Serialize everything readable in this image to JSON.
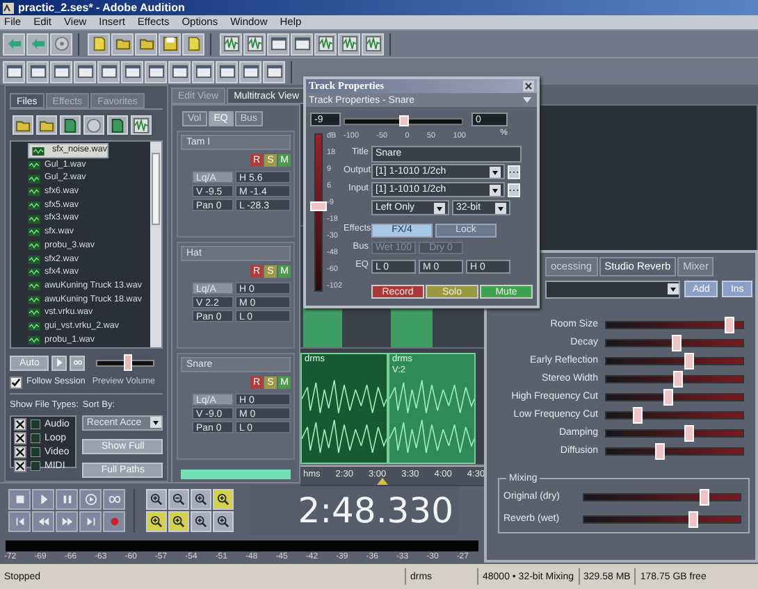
{
  "window": {
    "title": "practic_2.ses* - Adobe Audition"
  },
  "menu": [
    "File",
    "Edit",
    "View",
    "Insert",
    "Effects",
    "Options",
    "Window",
    "Help"
  ],
  "files_panel": {
    "tabs": [
      {
        "label": "Files",
        "selected": true
      },
      {
        "label": "Effects",
        "selected": false
      },
      {
        "label": "Favorites",
        "selected": false
      }
    ],
    "files": [
      {
        "name": "sfx_noise.wav",
        "selected": true
      },
      {
        "name": "Gul_1.wav",
        "selected": false
      },
      {
        "name": "Gul_2.wav",
        "selected": false
      },
      {
        "name": "sfx6.wav",
        "selected": false
      },
      {
        "name": "sfx5.wav",
        "selected": false
      },
      {
        "name": "sfx3.wav",
        "selected": false
      },
      {
        "name": "sfx.wav",
        "selected": false
      },
      {
        "name": "probu_3.wav",
        "selected": false
      },
      {
        "name": "sfx2.wav",
        "selected": false
      },
      {
        "name": "sfx4.wav",
        "selected": false
      },
      {
        "name": "awuKuning Truck 13.wav",
        "selected": false
      },
      {
        "name": "awuKuning Truck 18.wav",
        "selected": false
      },
      {
        "name": "vst.vrku.wav",
        "selected": false
      },
      {
        "name": "gui_vst.vrku_2.wav",
        "selected": false
      },
      {
        "name": "probu_1.wav",
        "selected": false
      }
    ],
    "autoplay": "Auto",
    "follow_session": {
      "label": "Follow Session",
      "checked": true
    },
    "preview_volume": {
      "label": "Preview Volume",
      "level": 0.55
    },
    "show_file_types": {
      "label": "Show File Types:",
      "types": [
        {
          "label": "Audio",
          "checked": true
        },
        {
          "label": "Loop",
          "checked": true
        },
        {
          "label": "Video",
          "checked": true
        },
        {
          "label": "MIDI",
          "checked": true
        }
      ]
    },
    "sort_by": {
      "label": "Sort By:",
      "value": "Recent Acce"
    },
    "buttons": [
      "Show Full",
      "Full Paths"
    ]
  },
  "views": [
    {
      "label": "Edit View",
      "selected": false
    },
    {
      "label": "Multitrack View",
      "selected": true
    }
  ],
  "mixer": {
    "tabs": [
      {
        "label": "Vol",
        "selected": false
      },
      {
        "label": "EQ",
        "selected": true
      },
      {
        "label": "Bus",
        "selected": false
      }
    ],
    "tracks": [
      {
        "name": "Tam I",
        "buttons": [
          {
            "label": "R",
            "color": "#b03c3c"
          },
          {
            "label": "S",
            "color": "#9c9a44"
          },
          {
            "label": "M",
            "color": "#4c9a4c"
          }
        ],
        "fields": [
          "Lq/A",
          "H 5.6",
          "V -9.5",
          "M -1.4",
          "Pan 0",
          "L -28.3"
        ]
      },
      {
        "name": "Hat",
        "buttons": [
          {
            "label": "R",
            "color": "#b03c3c"
          },
          {
            "label": "S",
            "color": "#9c9a44"
          },
          {
            "label": "M",
            "color": "#4c9a4c"
          }
        ],
        "fields": [
          "Lq/A",
          "H 0",
          "V 2.2",
          "M 0",
          "Pan 0",
          "L 0"
        ]
      },
      {
        "name": "Snare",
        "buttons": [
          {
            "label": "R",
            "color": "#b03c3c"
          },
          {
            "label": "S",
            "color": "#9c9a44"
          },
          {
            "label": "M",
            "color": "#4c9a4c"
          }
        ],
        "fields": [
          "Lq/A",
          "H 0",
          "V -9.0",
          "M 0",
          "Pan 0",
          "L 0"
        ]
      }
    ]
  },
  "timeline": {
    "clips": [
      {
        "label": "drms"
      },
      {
        "label": "drms",
        "sublabel": "V:2"
      }
    ],
    "ruler": [
      "hms",
      "2:30",
      "3:00",
      "3:30",
      "4:00",
      "4:30"
    ]
  },
  "track_properties": {
    "title": "Track Properties",
    "subtitle": "Track Properties - Snare",
    "volume": {
      "value": "-9",
      "level": 0.55,
      "scale": [
        "dB",
        "18",
        "9",
        "6",
        "-9",
        "-18",
        "-30",
        "-48",
        "-60",
        "-102"
      ]
    },
    "pan": {
      "value": "0",
      "level": 0.5,
      "ticks": [
        "-100",
        "-50",
        "0",
        "50",
        "100"
      ],
      "unit": "%"
    },
    "title_field": {
      "label": "Title",
      "value": "Snare"
    },
    "output": {
      "label": "Output",
      "value": "[1] 1-1010 1/2ch"
    },
    "input": {
      "label": "Input",
      "value": "[1] 1-1010 1/2ch"
    },
    "channel": "Left Only",
    "bits": "32-bit",
    "effects": {
      "label": "Effects",
      "buttons": [
        {
          "label": "FX/4",
          "on": true
        },
        {
          "label": "Lock",
          "on": false
        }
      ]
    },
    "bus": {
      "label": "Bus",
      "buttons": [
        {
          "label": "Wet 100",
          "disabled": true
        },
        {
          "label": "Dry 0",
          "disabled": true
        }
      ]
    },
    "eq": {
      "label": "EQ",
      "fields": [
        "L 0",
        "M 0",
        "H 0"
      ]
    },
    "buttons": [
      {
        "label": "Record",
        "color": "#a8383a"
      },
      {
        "label": "Solo",
        "color": "#9a9840"
      },
      {
        "label": "Mute",
        "color": "#3fa24e"
      }
    ]
  },
  "effects_rack": {
    "tabs": [
      {
        "label": "ocessing",
        "selected": false
      },
      {
        "label": "Studio Reverb",
        "selected": true
      },
      {
        "label": "Mixer",
        "selected": false
      }
    ],
    "add": "Add",
    "insert": "Ins",
    "params": [
      {
        "label": "Room Size",
        "level": 0.93
      },
      {
        "label": "Decay",
        "level": 0.52
      },
      {
        "label": "Early Reflection",
        "level": 0.61
      },
      {
        "label": "Stereo Width",
        "level": 0.53
      },
      {
        "label": "High Frequency Cut",
        "level": 0.45
      },
      {
        "label": "Low Frequency Cut",
        "level": 0.21
      },
      {
        "label": "Damping",
        "level": 0.61
      },
      {
        "label": "Diffusion",
        "level": 0.38
      }
    ],
    "mixing": {
      "label": "Mixing",
      "params": [
        {
          "label": "Original (dry)",
          "level": 0.79
        },
        {
          "label": "Reverb (wet)",
          "level": 0.71
        }
      ]
    }
  },
  "time": "2:48.330",
  "meter": [
    "-72",
    "-69",
    "-66",
    "-63",
    "-60",
    "-57",
    "-54",
    "-51",
    "-48",
    "-45",
    "-42",
    "-39",
    "-36",
    "-33",
    "-30",
    "-27"
  ],
  "status_bar": [
    "Stopped",
    "drms",
    "48000 • 32-bit Mixing",
    "329.58 MB",
    "178.75 GB free"
  ]
}
